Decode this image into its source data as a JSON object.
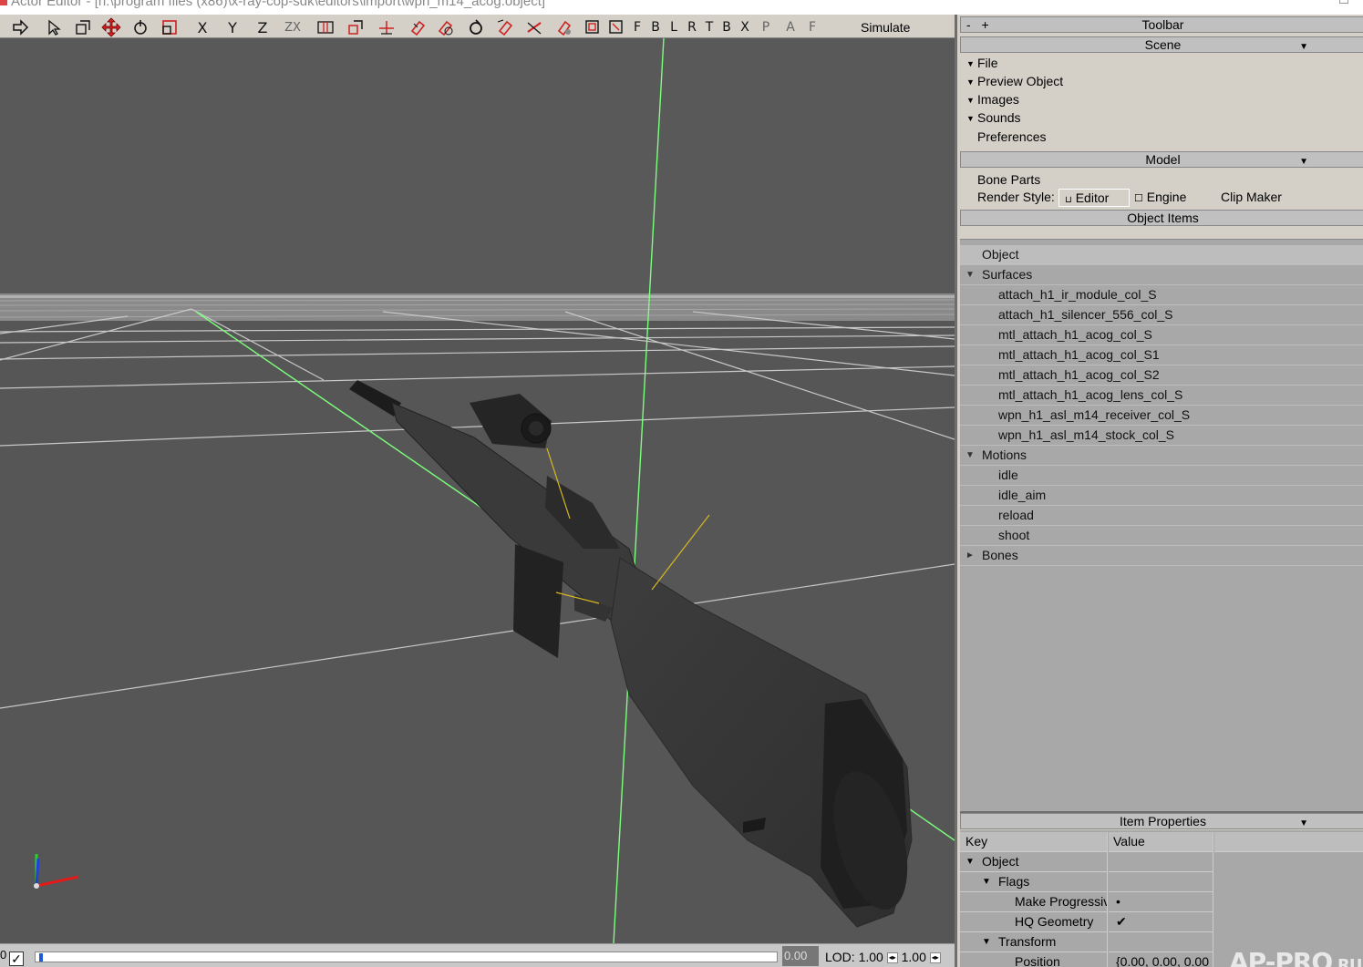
{
  "window": {
    "title": "Actor Editor - [h:\\program files (x86)\\x-ray-cop-sdk\\editors\\import\\wpn_m14_acog.object]"
  },
  "toolbar": {
    "letters": [
      "X",
      "Y",
      "Z",
      "ZX"
    ],
    "views": [
      "F",
      "B",
      "L",
      "R",
      "T",
      "B",
      "X",
      "P",
      "A",
      "F"
    ],
    "simulate_label": "Simulate"
  },
  "statusbar": {
    "frame": "0",
    "checked": true,
    "timeline_progress": 0.004,
    "time_value": "0.00",
    "lod_label": "LOD: 1.00",
    "lod_value2": "1.00"
  },
  "panel": {
    "toolbar_header": "Toolbar",
    "toolbar_buttons": "- +",
    "scene": {
      "header": "Scene",
      "items": [
        {
          "label": "File",
          "expanded": true
        },
        {
          "label": "Preview Object",
          "expanded": true
        },
        {
          "label": "Images",
          "expanded": true
        },
        {
          "label": "Sounds",
          "expanded": true
        },
        {
          "label": "Preferences",
          "expanded": false
        }
      ]
    },
    "model": {
      "header": "Model",
      "bone_parts": "Bone Parts",
      "render_style_label": "Render Style:",
      "editor_option": "Editor",
      "engine_option": "Engine",
      "clip_maker": "Clip Maker"
    },
    "object_items": {
      "header": "Object Items",
      "object_label": "Object",
      "surfaces_label": "Surfaces",
      "surfaces": [
        "attach_h1_ir_module_col_S",
        "attach_h1_silencer_556_col_S",
        "mtl_attach_h1_acog_col_S",
        "mtl_attach_h1_acog_col_S1",
        "mtl_attach_h1_acog_col_S2",
        "mtl_attach_h1_acog_lens_col_S",
        "wpn_h1_asl_m14_receiver_col_S",
        "wpn_h1_asl_m14_stock_col_S"
      ],
      "motions_label": "Motions",
      "motions": [
        "idle",
        "idle_aim",
        "reload",
        "shoot"
      ],
      "bones_label": "Bones"
    },
    "item_properties": {
      "header": "Item Properties",
      "key_header": "Key",
      "value_header": "Value",
      "object_label": "Object",
      "flags_label": "Flags",
      "make_progressive": "Make Progressiv",
      "make_progressive_value": "•",
      "hq_geometry": "HQ Geometry",
      "hq_geometry_value": "✔",
      "transform_label": "Transform",
      "position_label": "Position",
      "position_value": "{0.00, 0.00, 0.00"
    },
    "watermark": "AP-PRO",
    "watermark_suffix": ".RU"
  },
  "colors": {
    "viewport_bg": "#555555",
    "axis_green": "#7cff7c",
    "bone_yellow": "#d8b820",
    "panel_bg": "#d4d0c8",
    "tree_bg": "#a8a8a8"
  }
}
